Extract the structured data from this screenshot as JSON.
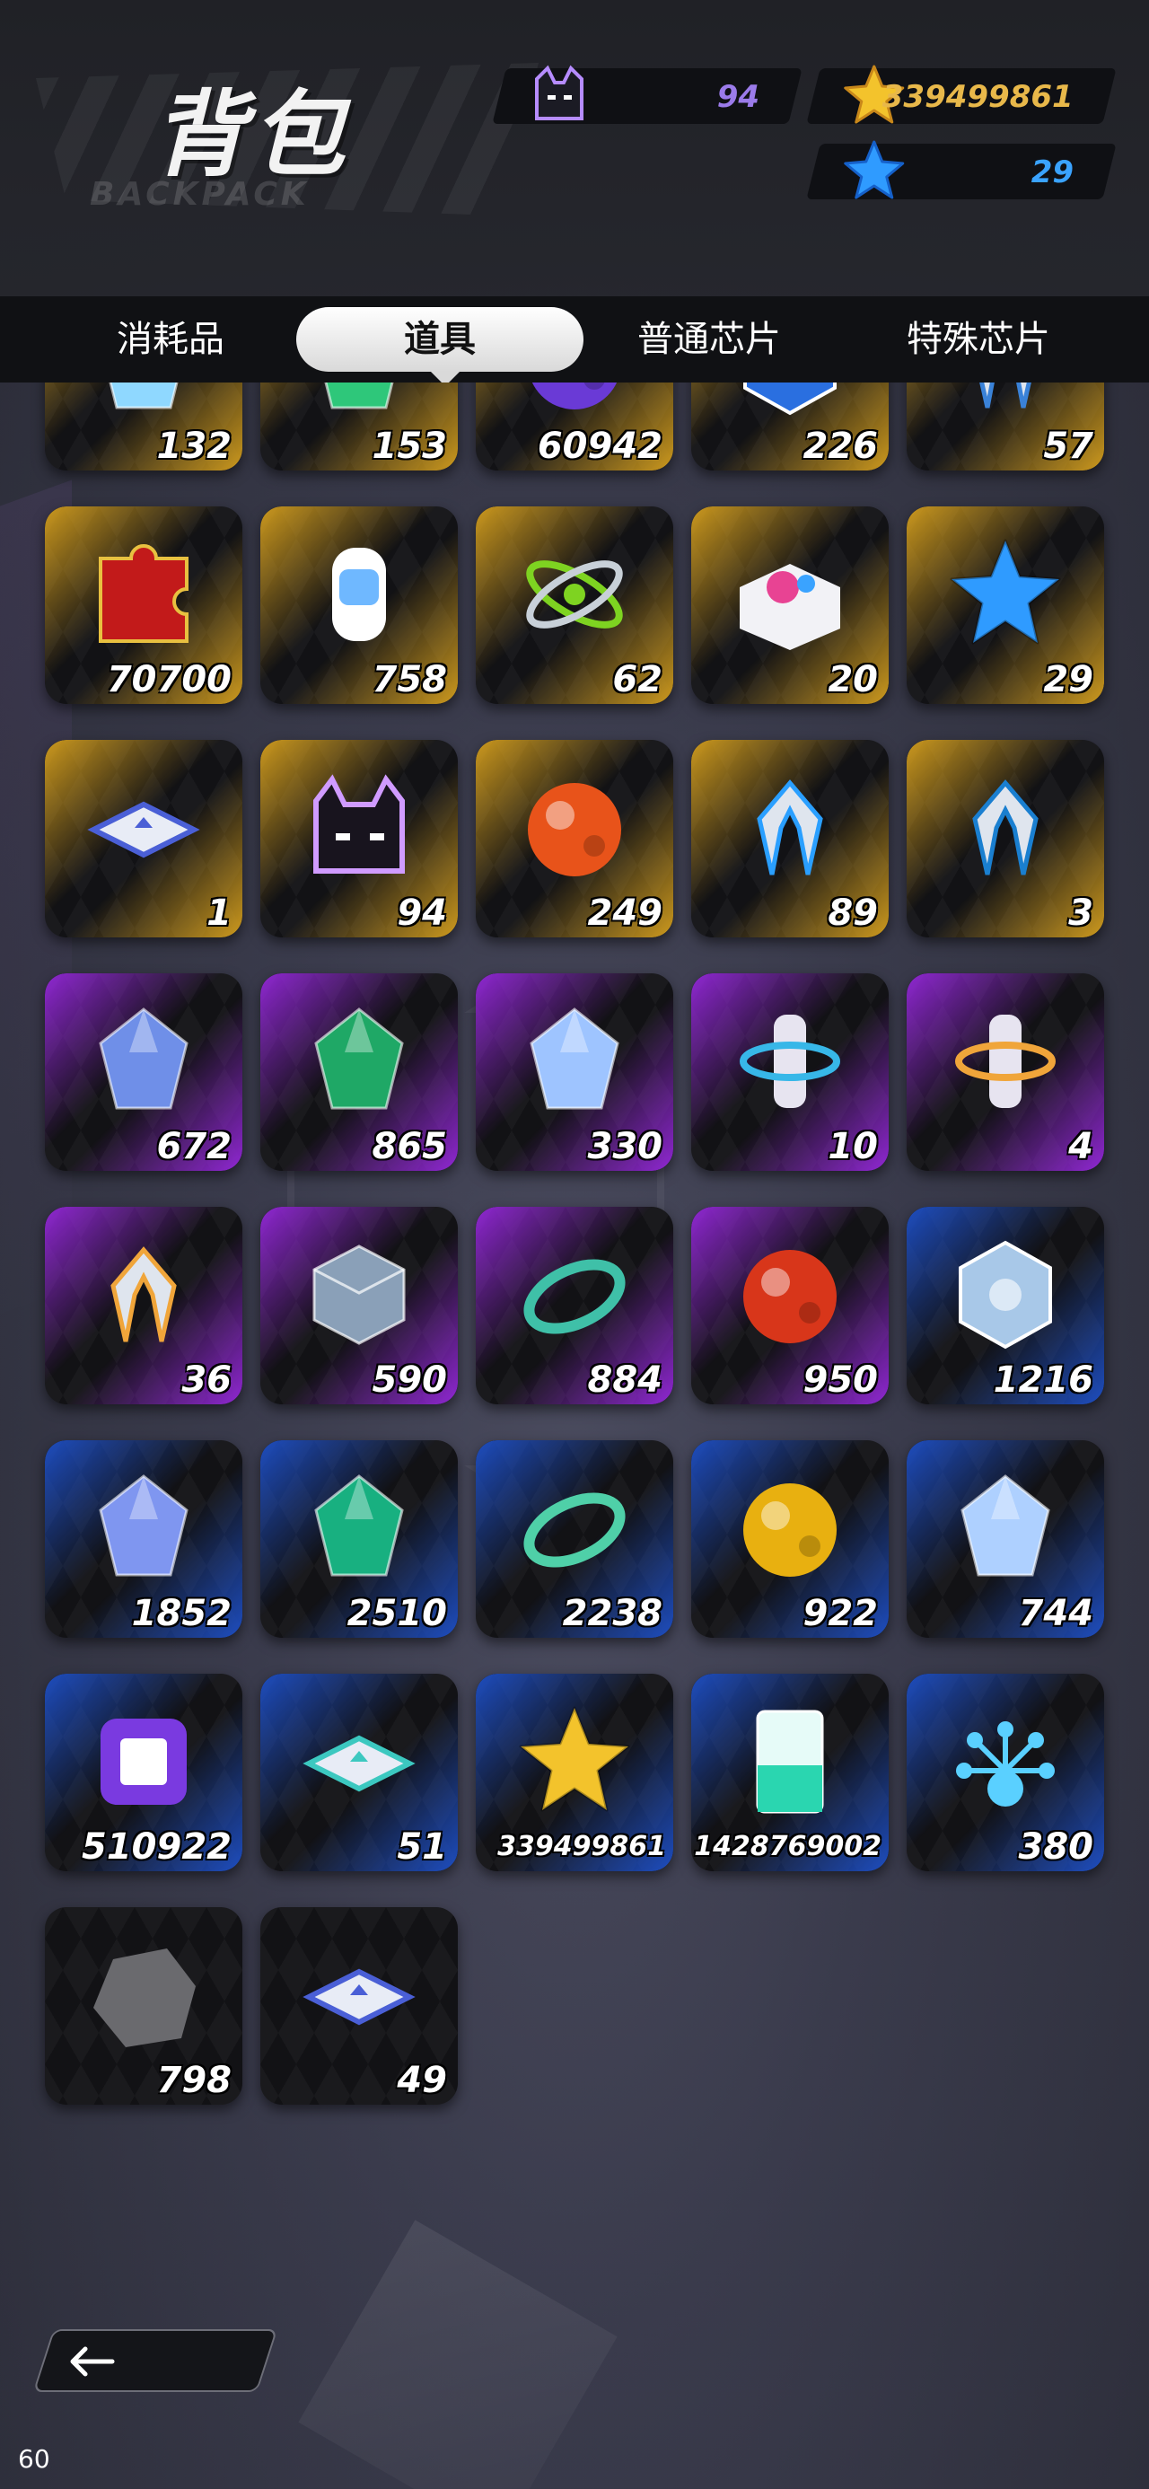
{
  "header": {
    "title": "背包",
    "subtitle": "BACKPACK"
  },
  "currencies": [
    {
      "name": "cat-coin",
      "value": "94",
      "color": "#9b7bea"
    },
    {
      "name": "gold-star",
      "value": "339499861",
      "color": "#e8b84a"
    },
    {
      "name": "blue-star",
      "value": "29",
      "color": "#3aa3ff"
    }
  ],
  "tabs": [
    {
      "label": "消耗品",
      "selected": false
    },
    {
      "label": "道具",
      "selected": true
    },
    {
      "label": "普通芯片",
      "selected": false
    },
    {
      "label": "特殊芯片",
      "selected": false
    }
  ],
  "items": [
    {
      "icon": "crystal-heart-icon",
      "count": "132",
      "rarity": "gold"
    },
    {
      "icon": "green-gem-icon",
      "count": "153",
      "rarity": "gold"
    },
    {
      "icon": "purple-skull-icon",
      "count": "60942",
      "rarity": "gold"
    },
    {
      "icon": "blue-hex-icon",
      "count": "226",
      "rarity": "gold"
    },
    {
      "icon": "white-claw-icon",
      "count": "57",
      "rarity": "gold"
    },
    {
      "icon": "red-puzzle-icon",
      "count": "70700",
      "rarity": "gold"
    },
    {
      "icon": "robot-capsule-icon",
      "count": "758",
      "rarity": "gold"
    },
    {
      "icon": "atom-rings-icon",
      "count": "62",
      "rarity": "gold"
    },
    {
      "icon": "paint-book-icon",
      "count": "20",
      "rarity": "gold"
    },
    {
      "icon": "blue-star-icon",
      "count": "29",
      "rarity": "gold"
    },
    {
      "icon": "ticket-card-icon",
      "count": "1",
      "rarity": "gold"
    },
    {
      "icon": "cat-head-icon",
      "count": "94",
      "rarity": "gold"
    },
    {
      "icon": "orange-orb-icon",
      "count": "249",
      "rarity": "gold"
    },
    {
      "icon": "mech-claw-blue-icon",
      "count": "89",
      "rarity": "gold"
    },
    {
      "icon": "mech-claw-white-icon",
      "count": "3",
      "rarity": "gold"
    },
    {
      "icon": "blue-crystal-icon",
      "count": "672",
      "rarity": "purple"
    },
    {
      "icon": "green-crystal-icon",
      "count": "865",
      "rarity": "purple"
    },
    {
      "icon": "crystal-shards-icon",
      "count": "330",
      "rarity": "purple"
    },
    {
      "icon": "blue-canister-icon",
      "count": "10",
      "rarity": "purple"
    },
    {
      "icon": "orange-canister-icon",
      "count": "4",
      "rarity": "purple"
    },
    {
      "icon": "emblem-icon",
      "count": "36",
      "rarity": "purple"
    },
    {
      "icon": "prism-cube-icon",
      "count": "590",
      "rarity": "purple"
    },
    {
      "icon": "teal-rings-icon",
      "count": "884",
      "rarity": "purple"
    },
    {
      "icon": "red-orb-icon",
      "count": "950",
      "rarity": "purple"
    },
    {
      "icon": "hex-badge-icon",
      "count": "1216",
      "rarity": "blue"
    },
    {
      "icon": "blue-crystal-small-icon",
      "count": "1852",
      "rarity": "blue"
    },
    {
      "icon": "green-gem-small-icon",
      "count": "2510",
      "rarity": "blue"
    },
    {
      "icon": "teal-ring-icon",
      "count": "2238",
      "rarity": "blue"
    },
    {
      "icon": "yellow-orb-icon",
      "count": "922",
      "rarity": "blue"
    },
    {
      "icon": "diamond-shard-icon",
      "count": "744",
      "rarity": "blue"
    },
    {
      "icon": "purple-chip-icon",
      "count": "510922",
      "rarity": "blue"
    },
    {
      "icon": "teal-manual-icon",
      "count": "51",
      "rarity": "blue"
    },
    {
      "icon": "gold-star-icon",
      "count": "339499861",
      "rarity": "blue"
    },
    {
      "icon": "terrarium-icon",
      "count": "1428769002",
      "rarity": "blue"
    },
    {
      "icon": "crystal-flower-icon",
      "count": "380",
      "rarity": "blue"
    },
    {
      "icon": "grey-rock-icon",
      "count": "798",
      "rarity": "black"
    },
    {
      "icon": "ticket-card-small-icon",
      "count": "49",
      "rarity": "black"
    }
  ],
  "footer": {
    "back_icon": "arrow-left-icon",
    "fps": "60"
  }
}
